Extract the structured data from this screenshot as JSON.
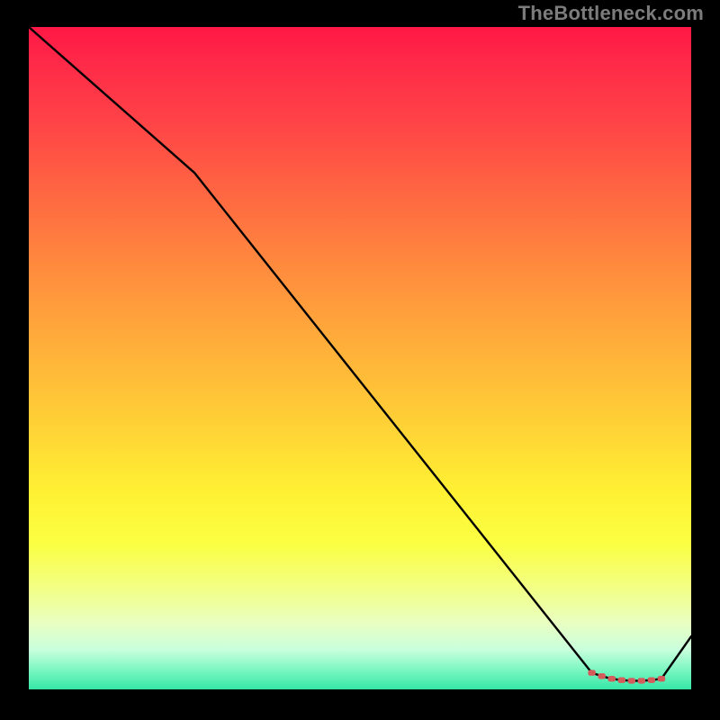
{
  "watermark": "TheBottleneck.com",
  "chart_data": {
    "type": "line",
    "title": "",
    "xlabel": "",
    "ylabel": "",
    "xlim": [
      0,
      100
    ],
    "ylim": [
      0,
      100
    ],
    "series": [
      {
        "name": "black-curve",
        "color": "#000000",
        "x": [
          0,
          25,
          85.0,
          86.5,
          88.0,
          89.5,
          91.0,
          92.5,
          94.0,
          95.5,
          100
        ],
        "values": [
          100,
          78,
          2.5,
          2.0,
          1.6,
          1.4,
          1.3,
          1.3,
          1.4,
          1.6,
          8
        ]
      }
    ],
    "highlight": {
      "name": "red-dots",
      "color": "#d65b5b",
      "x": [
        85.0,
        86.5,
        88.0,
        89.5,
        91.0,
        92.5,
        94.0,
        95.5
      ],
      "values": [
        2.5,
        2.0,
        1.6,
        1.4,
        1.3,
        1.3,
        1.4,
        1.6
      ]
    }
  }
}
